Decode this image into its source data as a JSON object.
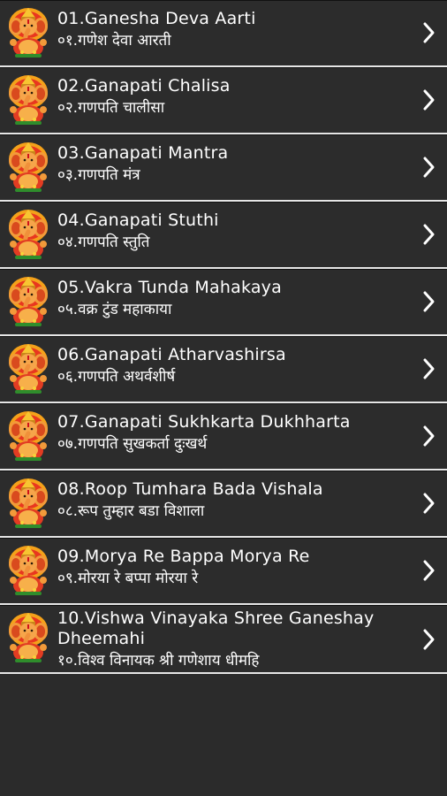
{
  "items": [
    {
      "title": "01.Ganesha Deva Aarti",
      "subtitle": "०१.गणेश देवा आरती",
      "icon": "ganesha-icon",
      "action_icon": "chevron-right-icon"
    },
    {
      "title": "02.Ganapati Chalisa",
      "subtitle": "०२.गणपति चालीसा",
      "icon": "ganesha-icon",
      "action_icon": "chevron-right-icon"
    },
    {
      "title": "03.Ganapati Mantra",
      "subtitle": "०३.गणपति मंत्र",
      "icon": "ganesha-icon",
      "action_icon": "chevron-right-icon"
    },
    {
      "title": "04.Ganapati Stuthi",
      "subtitle": "०४.गणपति स्तुति",
      "icon": "ganesha-icon",
      "action_icon": "chevron-right-icon"
    },
    {
      "title": "05.Vakra Tunda Mahakaya",
      "subtitle": "०५.वक्र टुंड महाकाया",
      "icon": "ganesha-icon",
      "action_icon": "chevron-right-icon"
    },
    {
      "title": "06.Ganapati Atharvashirsa",
      "subtitle": "०६.गणपति अथर्वशीर्ष",
      "icon": "ganesha-icon",
      "action_icon": "chevron-right-icon"
    },
    {
      "title": "07.Ganapati Sukhkarta Dukhharta",
      "subtitle": "०७.गणपति सुखकर्ता दुःखर्थ",
      "icon": "ganesha-icon",
      "action_icon": "chevron-right-icon"
    },
    {
      "title": "08.Roop Tumhara Bada Vishala",
      "subtitle": "०८.रूप तुम्हार बडा विशाला",
      "icon": "ganesha-icon",
      "action_icon": "chevron-right-icon"
    },
    {
      "title": "09.Morya Re Bappa Morya Re",
      "subtitle": "०९.मोरया रे बप्पा मोरया रे",
      "icon": "ganesha-icon",
      "action_icon": "chevron-right-icon"
    },
    {
      "title": "10.Vishwa Vinayaka Shree Ganeshay Dheemahi",
      "subtitle": "१०.विश्व विनायक श्री गणेशाय धीमहि",
      "icon": "ganesha-icon",
      "action_icon": "chevron-right-icon"
    }
  ],
  "colors": {
    "background": "#2b2b2b",
    "row_background": "#2c2c2c",
    "divider": "#e6e6e6",
    "text": "#ffffff"
  }
}
